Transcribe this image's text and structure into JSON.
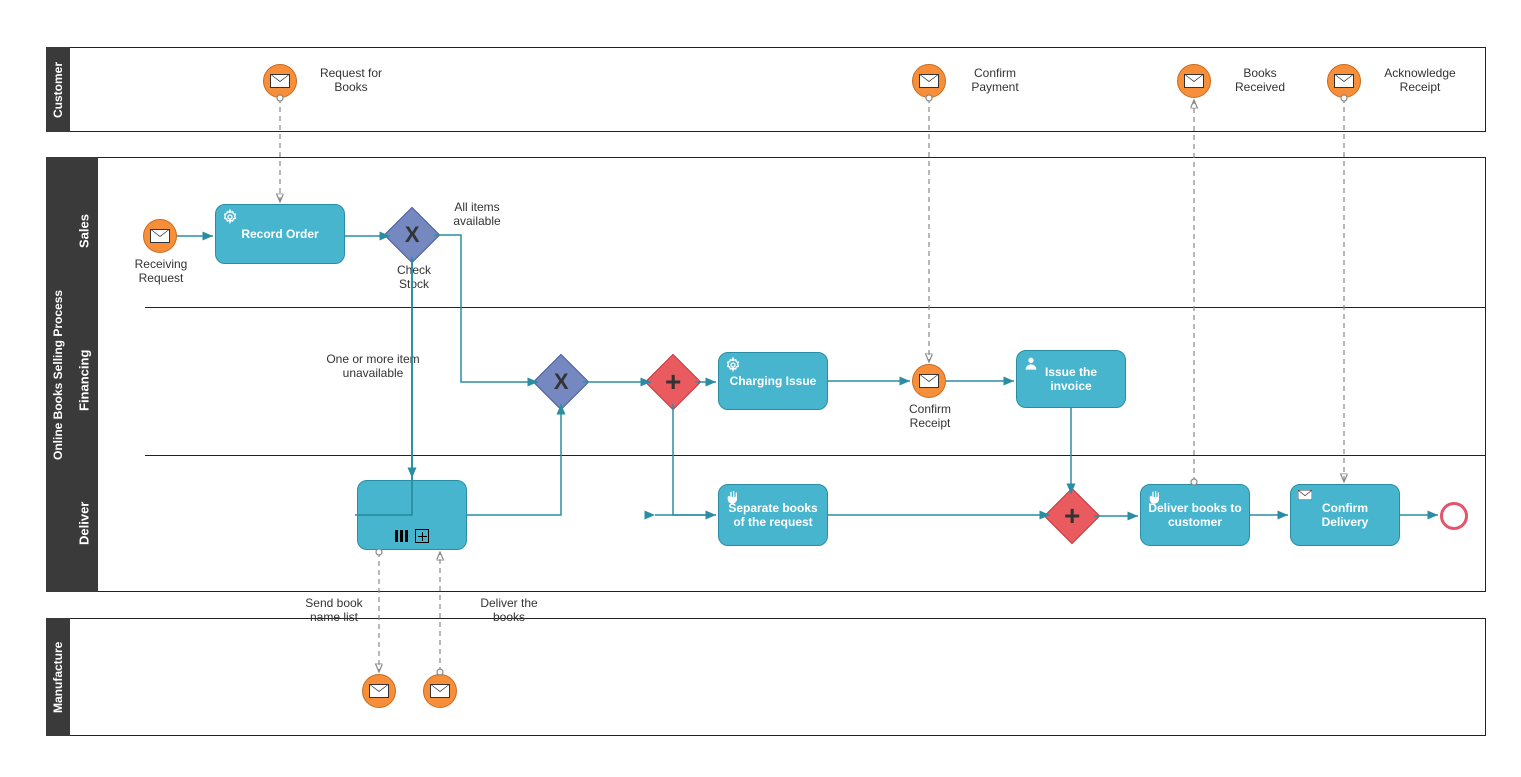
{
  "pools": {
    "customer": "Customer",
    "process": "Online Books Selling Process",
    "manufacture": "Manufacture"
  },
  "lanes": {
    "sales": "Sales",
    "financing": "Financing",
    "deliver": "Deliver"
  },
  "events": {
    "requestBooks": "Request for Books",
    "confirmPayment": "Confirm Payment",
    "booksReceived": "Books Received",
    "ackReceipt": "Acknowledge Receipt",
    "receivingRequest": "Receiving Request",
    "confirmReceipt": "Confirm Receipt",
    "sendBookNameList": "Send book name list",
    "deliverTheBooks": "Deliver the books"
  },
  "tasks": {
    "recordOrder": "Record Order",
    "chargingIssue": "Charging Issue",
    "issueInvoice": "Issue the invoice",
    "separateBooks": "Separate books of the request",
    "deliverBooks": "Deliver books to customer",
    "confirmDelivery": "Confirm Delivery",
    "subprocess": ""
  },
  "gateways": {
    "checkStock": "Check Stock",
    "x": "X",
    "plus": "+"
  },
  "flowLabels": {
    "allAvailable": "All items available",
    "unavailable": "One or more item unavailable"
  },
  "colors": {
    "task": "#47b5ce",
    "event": "#f78e3a",
    "gatewayBlue": "#7588c0",
    "gatewayRed": "#ea5b60",
    "poolHeader": "#3a3a3a",
    "arrow": "#2a8da3",
    "dash": "#888"
  }
}
